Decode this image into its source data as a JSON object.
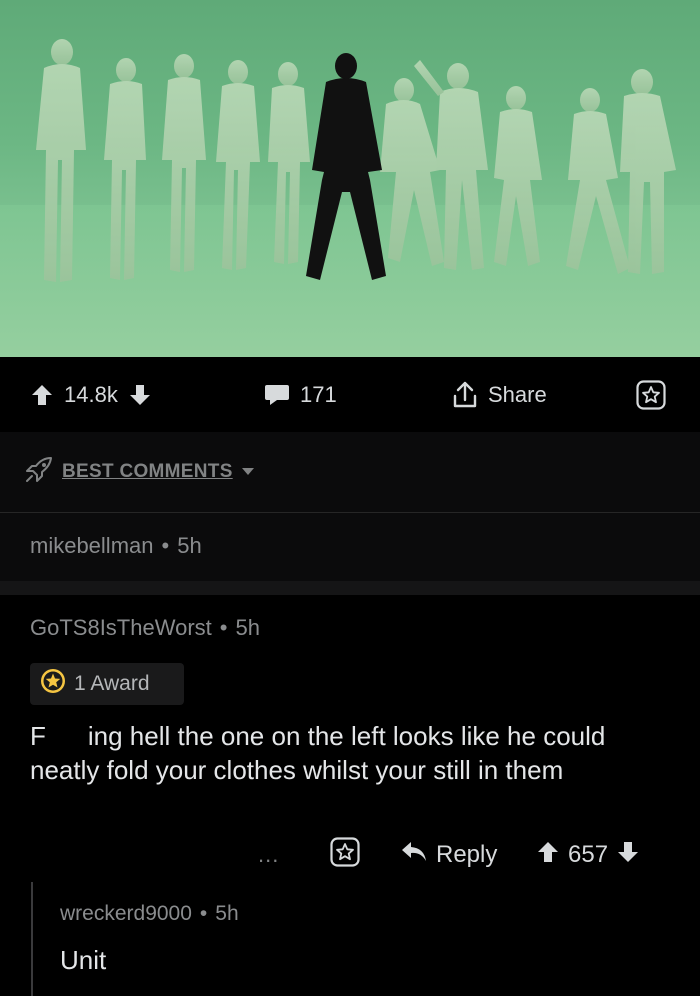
{
  "post": {
    "vote_count": "14.8k",
    "comment_count": "171",
    "share_label": "Share"
  },
  "sort": {
    "label": "BEST COMMENTS"
  },
  "comments": [
    {
      "author": "mikebellman",
      "separator": "•",
      "age": "5h",
      "collapsed": true
    },
    {
      "author": "GoTS8IsTheWorst",
      "separator": "•",
      "age": "5h",
      "award": "1 Award",
      "body_start": "F",
      "body_rest": "ing hell the one on the left looks like he could neatly fold your clothes whilst your still in them",
      "more_label": "...",
      "reply_label": "Reply",
      "score": "657",
      "replies": [
        {
          "author": "wreckerd9000",
          "separator": "•",
          "age": "5h",
          "body": "Unit"
        }
      ]
    }
  ],
  "icons": {
    "upvote": "arrow-up-icon",
    "downvote": "arrow-down-icon",
    "comment": "speech-bubble-icon",
    "share": "share-icon",
    "save": "star-icon",
    "sort": "rocket-icon",
    "reply": "reply-arrow-icon",
    "award": "award-star-icon"
  },
  "colors": {
    "background": "#000000",
    "text": "#d7dadc",
    "muted": "#818384",
    "award_gold": "#f5c542",
    "green_screen": "#7cc190"
  }
}
